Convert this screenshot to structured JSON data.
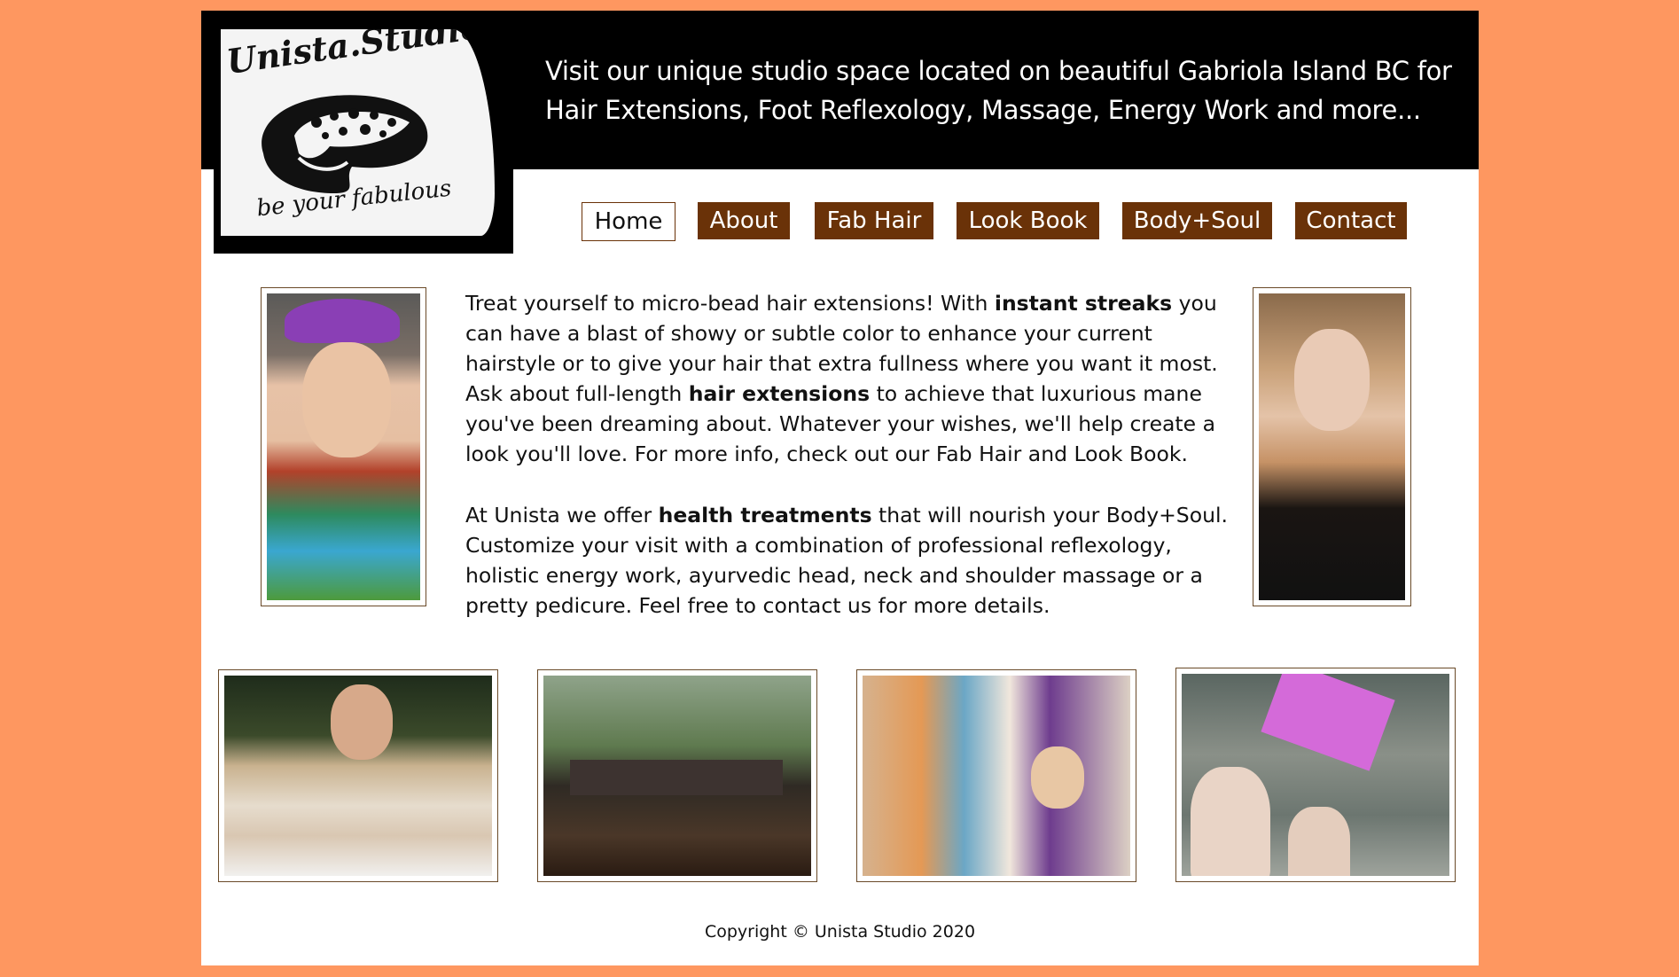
{
  "logo": {
    "name_text": "Unista.Studio",
    "slogan_text": "be your fabulous"
  },
  "header": {
    "tagline": "Visit our unique studio space located on beautiful Gabriola Island BC for Hair Extensions, Foot Reflexology, Massage, Energy Work and more..."
  },
  "nav": {
    "items": [
      {
        "label": "Home"
      },
      {
        "label": "About"
      },
      {
        "label": "Fab Hair"
      },
      {
        "label": "Look Book"
      },
      {
        "label": "Body+Soul"
      },
      {
        "label": "Contact"
      }
    ],
    "active": "Home"
  },
  "content": {
    "p1": {
      "t1": "Treat yourself to micro-bead hair extensions! With ",
      "b1": "instant streaks",
      "t2": " you can have a blast of showy or subtle color to enhance your current hairstyle or to give your hair that extra fullness where you want it most. Ask about full-length ",
      "b2": "hair extensions",
      "t3": " to achieve that luxurious mane you've been dreaming about. Whatever your wishes, we'll help create a look you'll love. For more info, check out our Fab Hair and Look Book."
    },
    "p2": {
      "t1": "At Unista we offer ",
      "b1": "health treatments",
      "t2": " that will nourish your Body+Soul. Customize your visit with a combination of professional reflexology, holistic energy work, ayurvedic head, neck and shoulder massage or a pretty pedicure. Feel free to contact us for more details."
    }
  },
  "footer": {
    "copyright": "Copyright © Unista Studio 2020"
  },
  "colors": {
    "page_bg": "#fe9760",
    "banner_bg": "#000000",
    "nav_bg": "#6a3208",
    "nav_text": "#ffffff"
  }
}
